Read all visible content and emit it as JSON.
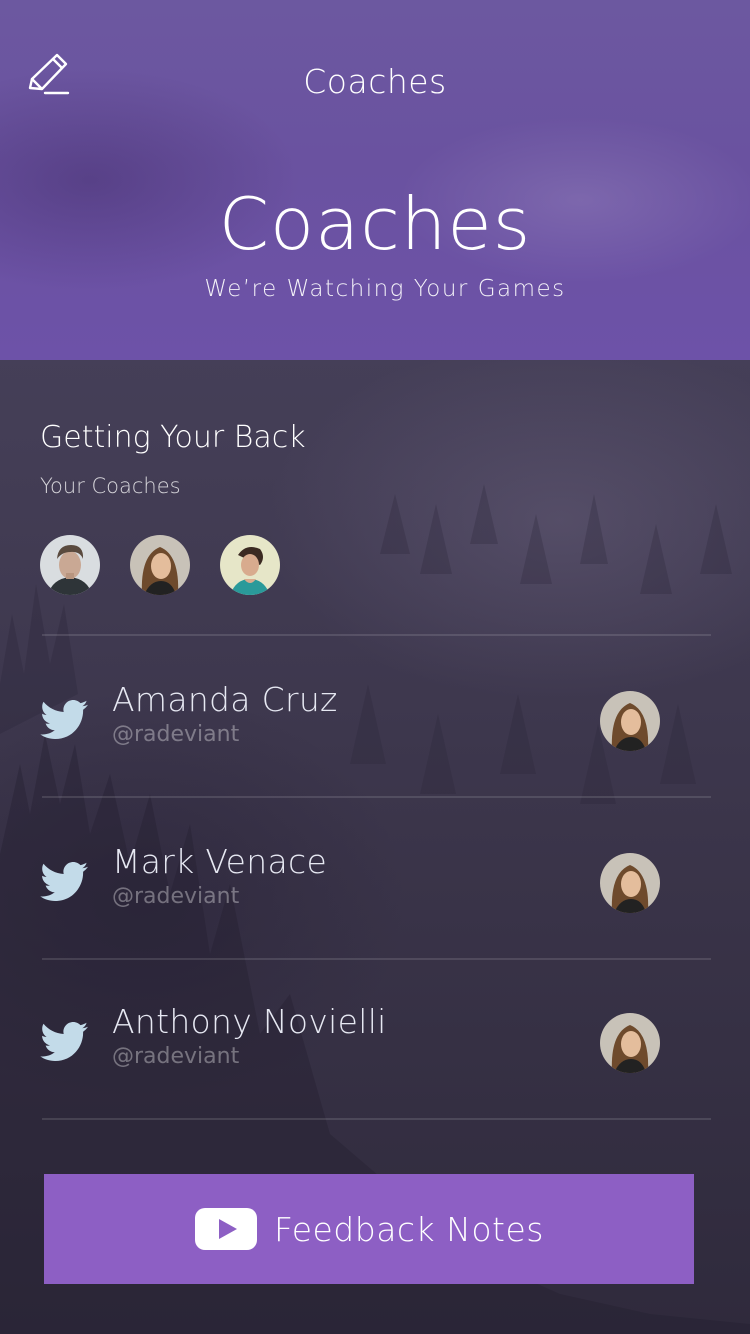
{
  "colors": {
    "header_purple": "#6a52a0",
    "button_purple": "#8d5fc4",
    "twitter_icon": "#c3dbe9"
  },
  "header": {
    "edit_icon": "pencil-edit-icon",
    "nav_title": "Coaches",
    "hero_title": "Coaches",
    "hero_subtitle": "We’re Watching Your Games"
  },
  "section": {
    "title": "Getting Your Back",
    "subtitle": "Your Coaches",
    "avatars": [
      "coach-avatar-man",
      "coach-avatar-woman",
      "coach-avatar-woman-looking-down"
    ]
  },
  "coaches": [
    {
      "name": "Amanda Cruz",
      "handle": "@radeviant",
      "icon": "twitter-icon"
    },
    {
      "name": "Mark Venace",
      "handle": "@radeviant",
      "icon": "twitter-icon"
    },
    {
      "name": "Anthony Novielli",
      "handle": "@radeviant",
      "icon": "twitter-icon"
    }
  ],
  "footer": {
    "button_label": "Feedback Notes",
    "button_icon": "play-icon"
  }
}
